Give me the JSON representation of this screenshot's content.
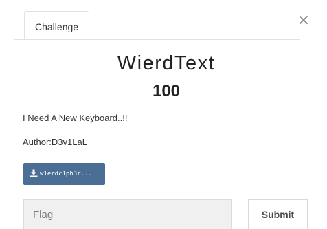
{
  "modal": {
    "close_label": "×",
    "tab_label": "Challenge"
  },
  "challenge": {
    "name": "WierdText",
    "value": "100",
    "description": "I Need A New Keyboard..!!",
    "author": "Author:D3v1LaL",
    "file_label": "w1erdc1ph3r...",
    "file_icon": "download-icon"
  },
  "submission": {
    "placeholder": "Flag",
    "submit_label": "Submit"
  },
  "colors": {
    "file_button_bg": "#4a6e94",
    "input_bg": "#f0f0f0"
  }
}
